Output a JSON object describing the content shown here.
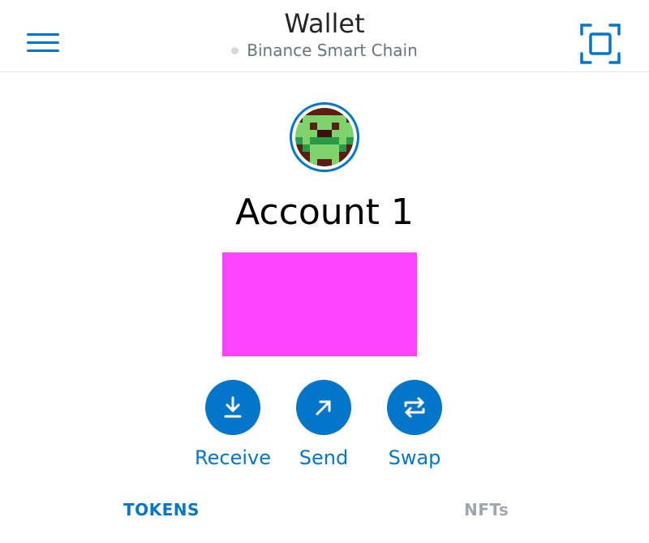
{
  "header": {
    "title": "Wallet",
    "network": "Binance Smart Chain",
    "menu_icon": "hamburger-menu-icon",
    "scan_icon": "qr-scan-icon"
  },
  "account": {
    "name": "Account 1"
  },
  "actions": [
    {
      "label": "Receive",
      "icon": "download-arrow-icon"
    },
    {
      "label": "Send",
      "icon": "arrow-up-right-icon"
    },
    {
      "label": "Swap",
      "icon": "swap-arrows-icon"
    }
  ],
  "tabs": [
    {
      "label": "TOKENS",
      "active": true
    },
    {
      "label": "NFTs",
      "active": false
    }
  ],
  "colors": {
    "accent": "#0376c9",
    "muted": "#9fa6ae",
    "redaction": "#ff44ff"
  }
}
